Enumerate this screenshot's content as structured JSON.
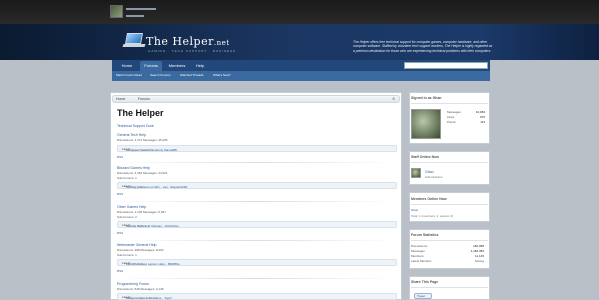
{
  "header": {
    "logo_main": "The Helper",
    "logo_suffix": ".net",
    "tagline": "GAMING · TECH SUPPORT · BUSINESS",
    "description": "The Helper offers free technical support for computer games, computer hardware, and other computer software. Staffed by volunteer tech support workers, The Helper is highly regarded as a premium destination for those who are experiencing technical problems with their computers."
  },
  "nav": {
    "tabs": [
      "Home",
      "Forums",
      "Members",
      "Help"
    ],
    "active": "Forums",
    "sub_links": [
      "Mark Forums Read",
      "Search Forums",
      "Watched Threads",
      "What's New?"
    ]
  },
  "breadcrumb": [
    "Home",
    "Forums"
  ],
  "page_title": "The Helper",
  "category": "Technical Support Zone",
  "forums": [
    {
      "title": "General Tech Help",
      "discussions": "4,371",
      "messages": "25,466",
      "sub": "",
      "latest": "Computer freezes randomly Samad88,",
      "date": "Monday at 4:56 PM",
      "rss": "RSS"
    },
    {
      "title": "Blizzard Games Help",
      "discussions": "4,364",
      "messages": "24,921",
      "sub": "Sub-Forums: 1",
      "latest": "Nothing problems on WC... can.. Slayder2318,",
      "date": "Apr 22, 2015",
      "rss": "RSS"
    },
    {
      "title": "Other Games Help",
      "discussions": "1,145",
      "messages": "6,997",
      "sub": "Sub-Forums: 2",
      "latest": "Serious Battlefield Vietnam... RobzClan,",
      "date": "Mar 26, 2015",
      "rss": "RSS"
    },
    {
      "title": "Webmaster General Help",
      "discussions": "998",
      "messages": "8,200",
      "sub": "Sub-Forums: 1",
      "latest": "First Photoshop Layout, Help... BDR80s,",
      "date": "Apr 29, 2015",
      "rss": "RSS"
    },
    {
      "title": "Programming Forum",
      "discussions": "545",
      "messages": "4,148",
      "sub": "",
      "latest": "Merge txt files and remove... SyaY,",
      "date": "Wednesday at 1:09 AM",
      "rss": ""
    }
  ],
  "sidebar": {
    "signed_in": "Signed in as Ghan",
    "user_stats": [
      {
        "label": "Messages:",
        "value": "10,084"
      },
      {
        "label": "Likes:",
        "value": "976"
      },
      {
        "label": "Points:",
        "value": "113"
      }
    ],
    "staff_head": "Staff Online Now",
    "staff_name": "Ghan",
    "staff_role": "Administrator",
    "members_head": "Members Online Now",
    "members_name": "Ghan",
    "members_note": "Total: 1 (members: 1, guests: 0)",
    "stats_head": "Forum Statistics",
    "forum_stats": [
      {
        "label": "Discussions:",
        "value": "182,958"
      },
      {
        "label": "Messages:",
        "value": "1,182,384"
      },
      {
        "label": "Members:",
        "value": "11,145"
      },
      {
        "label": "Latest Member:",
        "value": "belong"
      }
    ],
    "share_head": "Share This Page",
    "tweet": "Tweet"
  }
}
